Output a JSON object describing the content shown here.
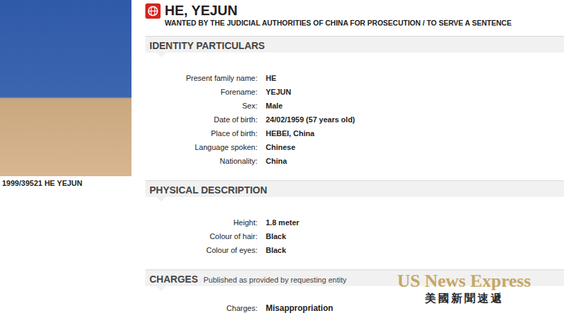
{
  "photo": {
    "caption": "1999/39521 HE YEJUN"
  },
  "notice": {
    "title": "HE, YEJUN",
    "subtitle": "WANTED BY THE JUDICIAL AUTHORITIES OF CHINA FOR PROSECUTION / TO SERVE A SENTENCE"
  },
  "sections": [
    {
      "title": "IDENTITY PARTICULARS",
      "rows": [
        {
          "label": "Present family name:",
          "value": "HE"
        },
        {
          "label": "Forename:",
          "value": "YEJUN"
        },
        {
          "label": "Sex:",
          "value": "Male"
        },
        {
          "label": "Date of birth:",
          "value": "24/02/1959 (57 years old)"
        },
        {
          "label": "Place of birth:",
          "value": "HEBEI, China"
        },
        {
          "label": "Language spoken:",
          "value": "Chinese"
        },
        {
          "label": "Nationality:",
          "value": "China"
        }
      ]
    },
    {
      "title": "PHYSICAL DESCRIPTION",
      "rows": [
        {
          "label": "Height:",
          "value": "1.8 meter"
        },
        {
          "label": "Colour of hair:",
          "value": "Black"
        },
        {
          "label": "Colour of eyes:",
          "value": "Black"
        }
      ]
    },
    {
      "title": "CHARGES",
      "note": "Published as provided by requesting entity",
      "rows": [
        {
          "label": "Charges:",
          "value": "Misappropriation"
        }
      ]
    }
  ],
  "watermark": {
    "title": "US News Express",
    "subtitle": "美國新聞速遞"
  }
}
